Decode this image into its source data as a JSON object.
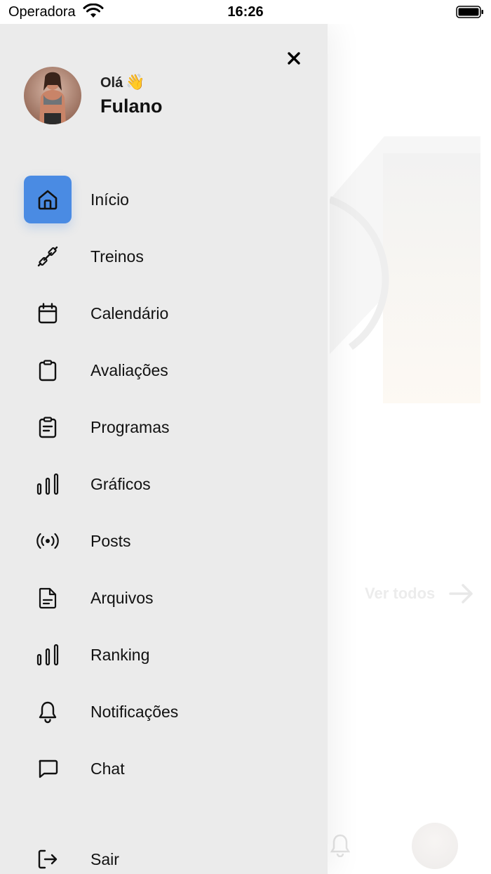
{
  "status_bar": {
    "carrier": "Operadora",
    "time": "16:26"
  },
  "background": {
    "see_all_label": "Ver todos"
  },
  "drawer": {
    "greeting": "Olá",
    "greeting_emoji": "👋",
    "user_name": "Fulano",
    "menu": [
      {
        "label": "Início",
        "icon": "home-icon",
        "active": true
      },
      {
        "label": "Treinos",
        "icon": "dumbbell-icon",
        "active": false
      },
      {
        "label": "Calendário",
        "icon": "calendar-icon",
        "active": false
      },
      {
        "label": "Avaliações",
        "icon": "clipboard-icon",
        "active": false
      },
      {
        "label": "Programas",
        "icon": "clipboard-list-icon",
        "active": false
      },
      {
        "label": "Gráficos",
        "icon": "bar-chart-icon",
        "active": false
      },
      {
        "label": "Posts",
        "icon": "broadcast-icon",
        "active": false
      },
      {
        "label": "Arquivos",
        "icon": "file-icon",
        "active": false
      },
      {
        "label": "Ranking",
        "icon": "bar-chart-icon",
        "active": false
      },
      {
        "label": "Notificações",
        "icon": "bell-icon",
        "active": false
      },
      {
        "label": "Chat",
        "icon": "chat-icon",
        "active": false
      }
    ],
    "logout_label": "Sair",
    "logout_icon": "logout-icon"
  },
  "colors": {
    "accent": "#4a8be3",
    "drawer_bg": "#ebebeb"
  }
}
